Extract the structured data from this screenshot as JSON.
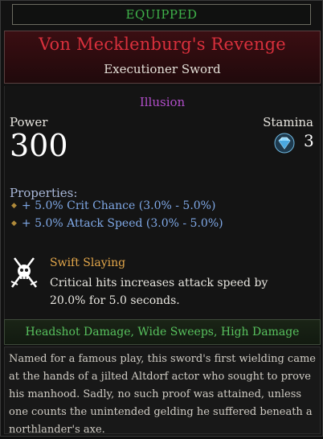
{
  "equipped": {
    "label": "EQUIPPED"
  },
  "item": {
    "name": "Von Mecklenburg's Revenge",
    "type": "Executioner Sword",
    "rarity": "Illusion"
  },
  "stats": {
    "power_label": "Power",
    "power_value": "300",
    "stamina_label": "Stamina",
    "stamina_value": "3",
    "stamina_icon": "shield-gem-icon"
  },
  "properties": {
    "label": "Properties:",
    "items": [
      "+ 5.0% Crit Chance (3.0% - 5.0%)",
      "+ 5.0% Attack Speed (3.0% - 5.0%)"
    ]
  },
  "talent": {
    "icon": "skull-swords-icon",
    "name": "Swift Slaying",
    "description": "Critical hits increases attack speed by 20.0% for 5.0 seconds."
  },
  "traits": {
    "text": "Headshot Damage, Wide Sweeps, High Damage"
  },
  "lore": {
    "text": "Named for a famous play, this sword's first wielding came at the hands of a jilted Altdorf actor who sought to prove his manhood. Sadly, no such proof was attained, unless one counts the unintended gelding he suffered beneath a northlander's axe."
  },
  "colors": {
    "equipped": "#3fb34a",
    "name": "#d9303c",
    "rarity": "#b14ec9",
    "property": "#7fa8e6",
    "talent_name": "#e2a64a",
    "traits": "#58c25e"
  }
}
